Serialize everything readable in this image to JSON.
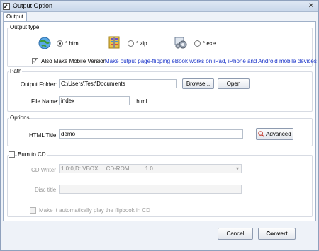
{
  "window": {
    "title": "Output Option"
  },
  "tabs": [
    {
      "label": "Output"
    }
  ],
  "output_type": {
    "title": "Output type",
    "options": [
      {
        "label": "*.html",
        "selected": true
      },
      {
        "label": "*.zip",
        "selected": false
      },
      {
        "label": "*.exe",
        "selected": false
      }
    ],
    "mobile_checkbox_label": "Also Make Mobile Version",
    "mobile_checked": true,
    "mobile_note": "Make output page-flipping eBook works on iPad, iPhone and Android mobile devices"
  },
  "path": {
    "title": "Path",
    "output_folder_label": "Output Folder:",
    "output_folder_value": "C:\\Users\\Test\\Documents",
    "browse_label": "Browse...",
    "open_label": "Open",
    "file_name_label": "File Name:",
    "file_name_value": "index",
    "file_ext": ".html"
  },
  "options": {
    "title": "Options",
    "html_title_label": "HTML Title:",
    "html_title_value": "demo",
    "advanced_label": "Advanced"
  },
  "burn": {
    "checkbox_label": "Burn to CD",
    "checked": false,
    "cd_writer_label": "CD Writer",
    "cd_writer_value": "1:0:0,D: VBOX     CD-ROM          1.0",
    "disc_title_label": "Disc title:",
    "disc_title_value": "",
    "autoplay_label": "Make it automatically play the flipbook in CD"
  },
  "footer": {
    "cancel_label": "Cancel",
    "convert_label": "Convert"
  },
  "colors": {
    "accent_note": "#1a34c9",
    "title_bg": "#c9d7ea"
  }
}
